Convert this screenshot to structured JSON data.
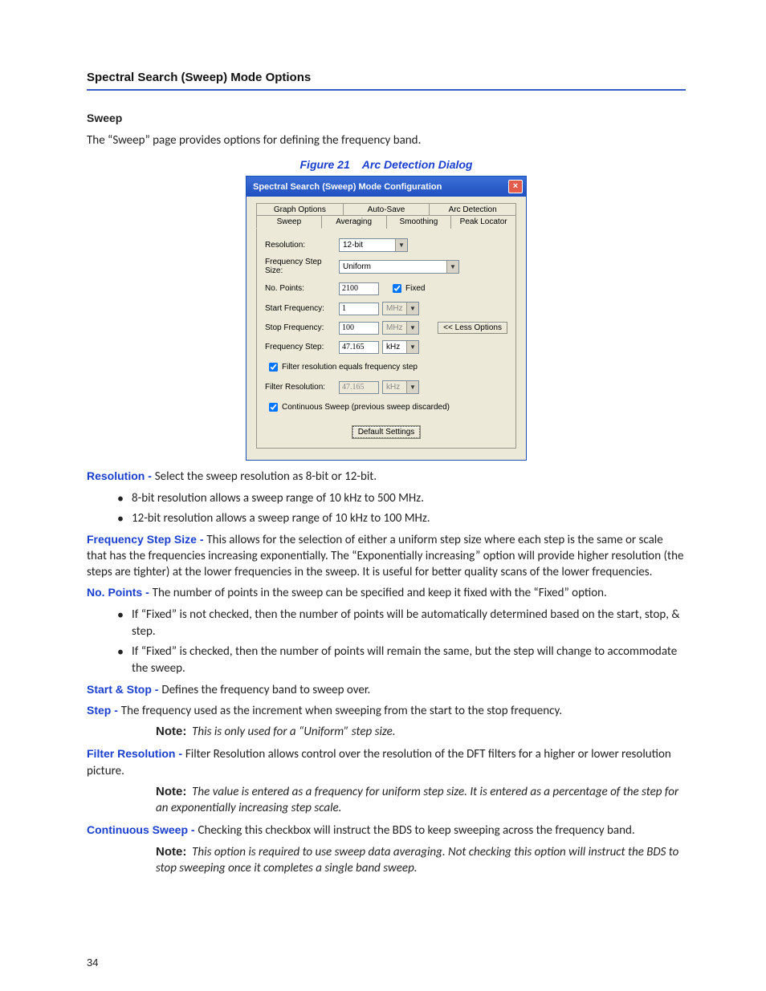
{
  "header": {
    "title": "Spectral Search (Sweep) Mode Options"
  },
  "sweep_section": {
    "heading": "Sweep",
    "intro": "The “Sweep” page provides options for defining the frequency band."
  },
  "figure": {
    "label": "Figure 21",
    "title": "Arc Detection Dialog"
  },
  "dialog": {
    "title": "Spectral Search (Sweep) Mode Configuration",
    "tabs_top": [
      "Graph Options",
      "Auto-Save",
      "Arc Detection"
    ],
    "tabs_bottom": [
      "Sweep",
      "Averaging",
      "Smoothing",
      "Peak Locator"
    ],
    "fields": {
      "resolution_label": "Resolution:",
      "resolution_value": "12-bit",
      "freq_step_size_label": "Frequency Step Size:",
      "freq_step_size_value": "Uniform",
      "no_points_label": "No. Points:",
      "no_points_value": "2100",
      "fixed_label": "Fixed",
      "start_freq_label": "Start Frequency:",
      "start_freq_value": "1",
      "start_freq_unit": "MHz",
      "stop_freq_label": "Stop Frequency:",
      "stop_freq_value": "100",
      "stop_freq_unit": "MHz",
      "less_options_btn": "<< Less Options",
      "freq_step_label": "Frequency Step:",
      "freq_step_value": "47.165",
      "freq_step_unit": "kHz",
      "filter_eq_label": "Filter resolution equals frequency step",
      "filter_res_label": "Filter Resolution:",
      "filter_res_value": "47.165",
      "filter_res_unit": "kHz",
      "cont_sweep_label": "Continuous Sweep (previous sweep discarded)",
      "default_btn": "Default Settings"
    }
  },
  "definitions": {
    "resolution": {
      "term": "Resolution - ",
      "text": "Select the sweep resolution as 8-bit or 12-bit.",
      "bullets": [
        "8-bit resolution allows a sweep range of 10 kHz to 500 MHz.",
        "12-bit resolution allows a sweep range of 10 kHz to 100 MHz."
      ]
    },
    "freq_step_size": {
      "term": "Frequency Step Size - ",
      "text": "This allows for the selection of either a uniform step size where each step is the same or scale that has the frequencies increasing exponentially. The “Exponentially increasing” option will provide higher resolution (the steps are tighter) at the lower frequencies in the sweep. It is useful for better quality scans of the lower frequencies."
    },
    "no_points": {
      "term": "No. Points - ",
      "text": "The number of points in the sweep can be specified and keep it fixed with the “Fixed” option.",
      "bullets": [
        "If “Fixed” is not checked, then the number of points will be automatically determined based on the start, stop, & step.",
        "If “Fixed” is checked, then the number of points will remain the same, but the step will change to accommodate the sweep."
      ]
    },
    "start_stop": {
      "term": "Start & Stop - ",
      "text": "Defines the frequency band to sweep over."
    },
    "step": {
      "term": "Step - ",
      "text": "The frequency used as the increment when sweeping from the start to the stop frequency.",
      "note": "This is only used for a “Uniform” step size."
    },
    "filter_resolution": {
      "term": "Filter Resolution - ",
      "text": "Filter Resolution allows control over the resolution of the DFT filters for a higher or lower resolution picture.",
      "note": "The value is entered as a frequency for uniform step size. It is entered as a percentage of the step for an exponentially increasing step scale."
    },
    "continuous_sweep": {
      "term": "Continuous Sweep - ",
      "text": "Checking this checkbox will instruct the BDS to keep sweeping across the frequency band.",
      "note": "This option is required to use sweep data averaging. Not checking this option will instruct the BDS to stop sweeping once it completes a single band sweep."
    }
  },
  "labels": {
    "note": "Note:"
  },
  "page_number": "34"
}
